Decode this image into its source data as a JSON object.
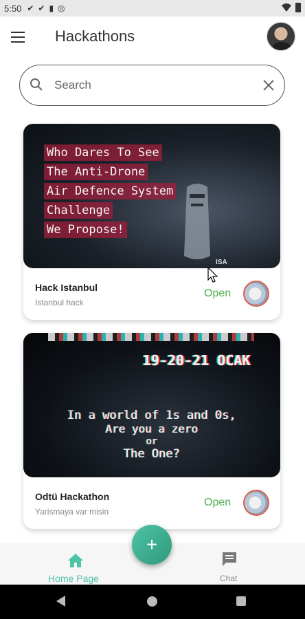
{
  "status_bar": {
    "time": "5:50"
  },
  "app_bar": {
    "title": "Hackathons"
  },
  "search": {
    "placeholder": "Search"
  },
  "cards": [
    {
      "image_lines": [
        "Who Dares To See",
        "The Anti-Drone",
        "Air Defence System",
        "Challenge",
        "We Propose!"
      ],
      "image_tag": "ISA",
      "title": "Hack Istanbul",
      "subtitle": "Istanbul hack",
      "status": "Open"
    },
    {
      "image_date": "19-20-21 OCAK",
      "image_lines": [
        "In a world of 1s and 0s,",
        "Are you a zero",
        "or",
        "The One?"
      ],
      "title": "Odtü Hackathon",
      "subtitle": "Yarismaya var misin",
      "status": "Open"
    }
  ],
  "bottom_nav": {
    "home_label": "Home Page",
    "chat_label": "Chat",
    "fab_icon": "+"
  },
  "colors": {
    "accent": "#4fc3a6",
    "status_open": "#4caf50"
  }
}
